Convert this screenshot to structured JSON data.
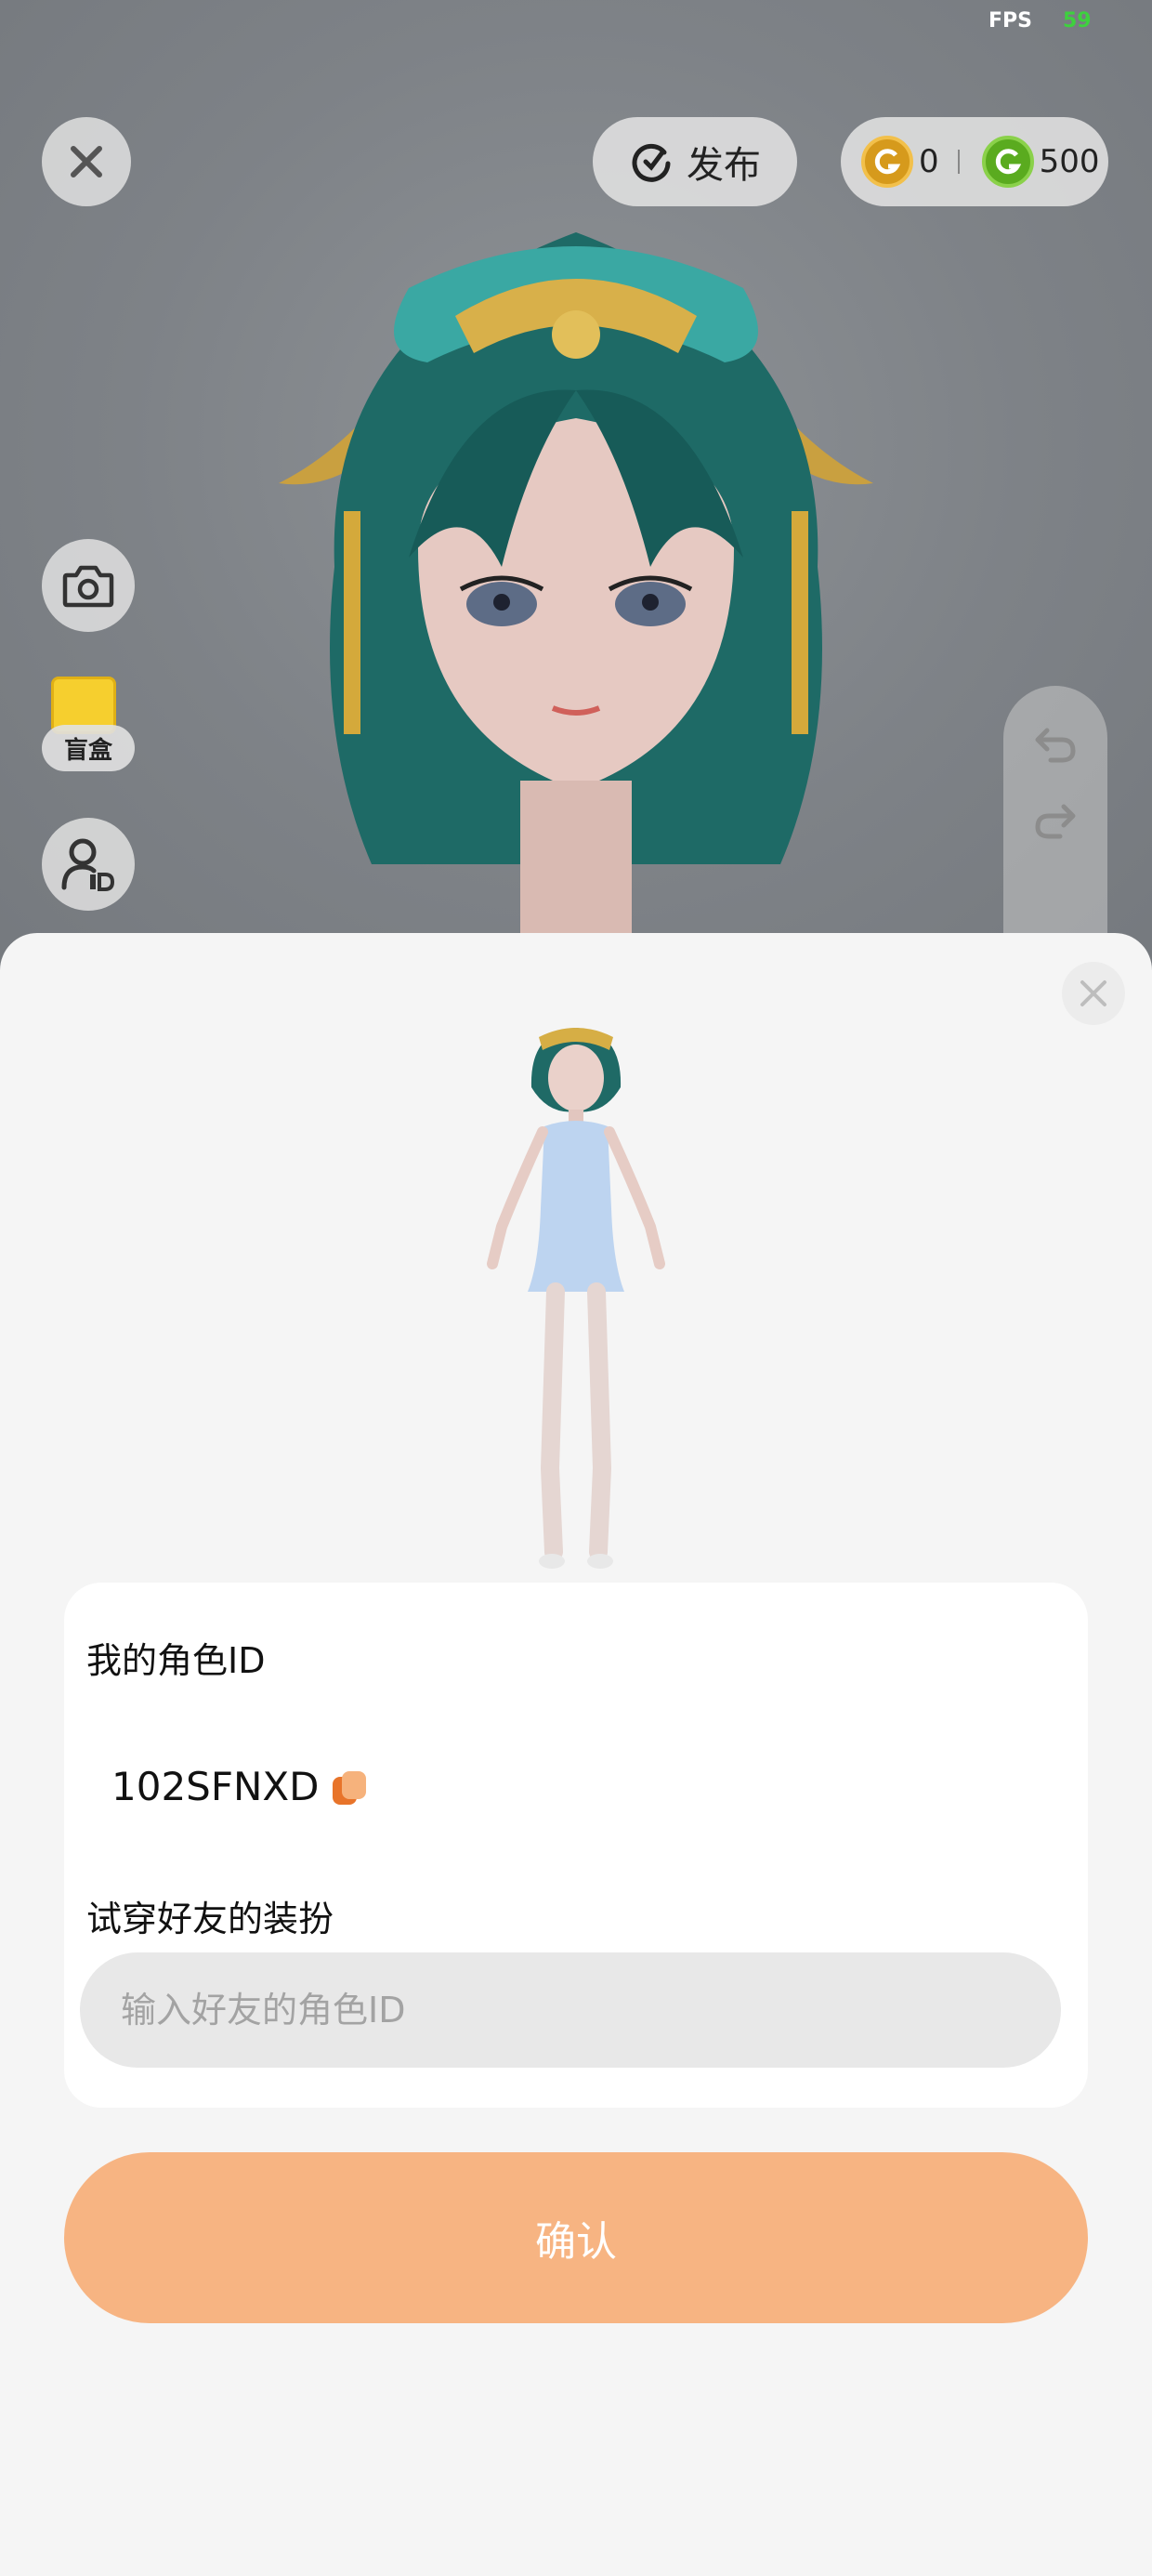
{
  "status": {
    "fps_label": "FPS",
    "fps_value": "59"
  },
  "toolbar": {
    "publish_label": "发布",
    "gold_coins": "0",
    "green_coins": "500"
  },
  "side_tools": {
    "blindbox_label": "盲盒"
  },
  "sheet": {
    "my_id_title": "我的角色ID",
    "my_id_value": "102SFNXD",
    "try_title": "试穿好友的装扮",
    "friend_id_placeholder": "输入好友的角色ID",
    "friend_id_value": "",
    "confirm_label": "确认"
  },
  "colors": {
    "accent_confirm": "#f7b482",
    "fps_green": "#3ed13e",
    "gold_coin": "#d69a1c",
    "green_coin": "#5aab1f"
  },
  "icons": [
    "close-icon",
    "reload-publish-icon",
    "gold-coin-icon",
    "green-coin-icon",
    "camera-icon",
    "blindbox-icon",
    "person-id-icon",
    "undo-icon",
    "redo-icon",
    "copy-icon"
  ]
}
